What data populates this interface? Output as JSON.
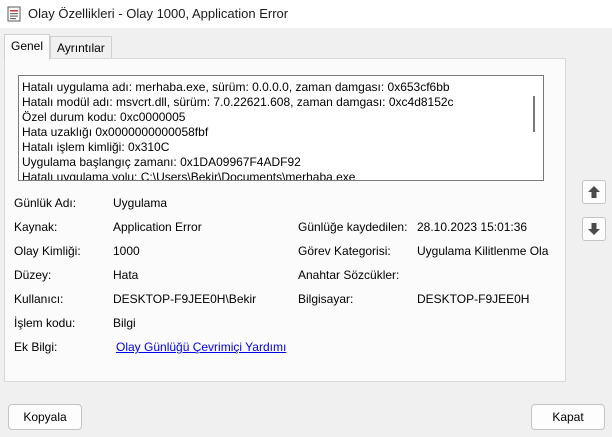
{
  "window": {
    "title": "Olay Özellikleri - Olay 1000, Application Error",
    "icon": "event-viewer-icon"
  },
  "tabs": [
    {
      "label": "Genel",
      "active": true
    },
    {
      "label": "Ayrıntılar",
      "active": false
    }
  ],
  "description_lines": [
    "Hatalı uygulama adı: merhaba.exe, sürüm: 0.0.0.0, zaman damgası: 0x653cf6bb",
    "Hatalı modül adı: msvcrt.dll, sürüm: 7.0.22621.608, zaman damgası: 0xc4d8152c",
    "Özel durum kodu: 0xc0000005",
    "Hata uzaklığı 0x0000000000058fbf",
    "Hatalı işlem kimliği: 0x310C",
    "Uygulama başlangıç zamanı: 0x1DA09967F4ADF92",
    "Hatalı uygulama yolu: C:\\Users\\Bekir\\Documents\\merhaba.exe"
  ],
  "fields": {
    "log_name": {
      "label": "Günlük Adı:",
      "value": "Uygulama"
    },
    "source": {
      "label": "Kaynak:",
      "value": "Application Error"
    },
    "logged": {
      "label": "Günlüğe kaydedilen:",
      "value": "28.10.2023 15:01:36"
    },
    "event_id": {
      "label": "Olay Kimliği:",
      "value": "1000"
    },
    "task_category": {
      "label": "Görev Kategorisi:",
      "value": "Uygulama Kilitlenme Ola"
    },
    "level": {
      "label": "Düzey:",
      "value": "Hata"
    },
    "keywords": {
      "label": "Anahtar Sözcükler:",
      "value": ""
    },
    "user": {
      "label": "Kullanıcı:",
      "value": "DESKTOP-F9JEE0H\\Bekir"
    },
    "computer": {
      "label": "Bilgisayar:",
      "value": "DESKTOP-F9JEE0H"
    },
    "opcode": {
      "label": "İşlem kodu:",
      "value": "Bilgi"
    },
    "more_info": {
      "label": "Ek Bilgi:",
      "link": "Olay Günlüğü Çevrimiçi Yardımı"
    }
  },
  "buttons": {
    "copy": "Kopyala",
    "close": "Kapat",
    "previous_icon": "arrow-up-icon",
    "next_icon": "arrow-down-icon"
  }
}
